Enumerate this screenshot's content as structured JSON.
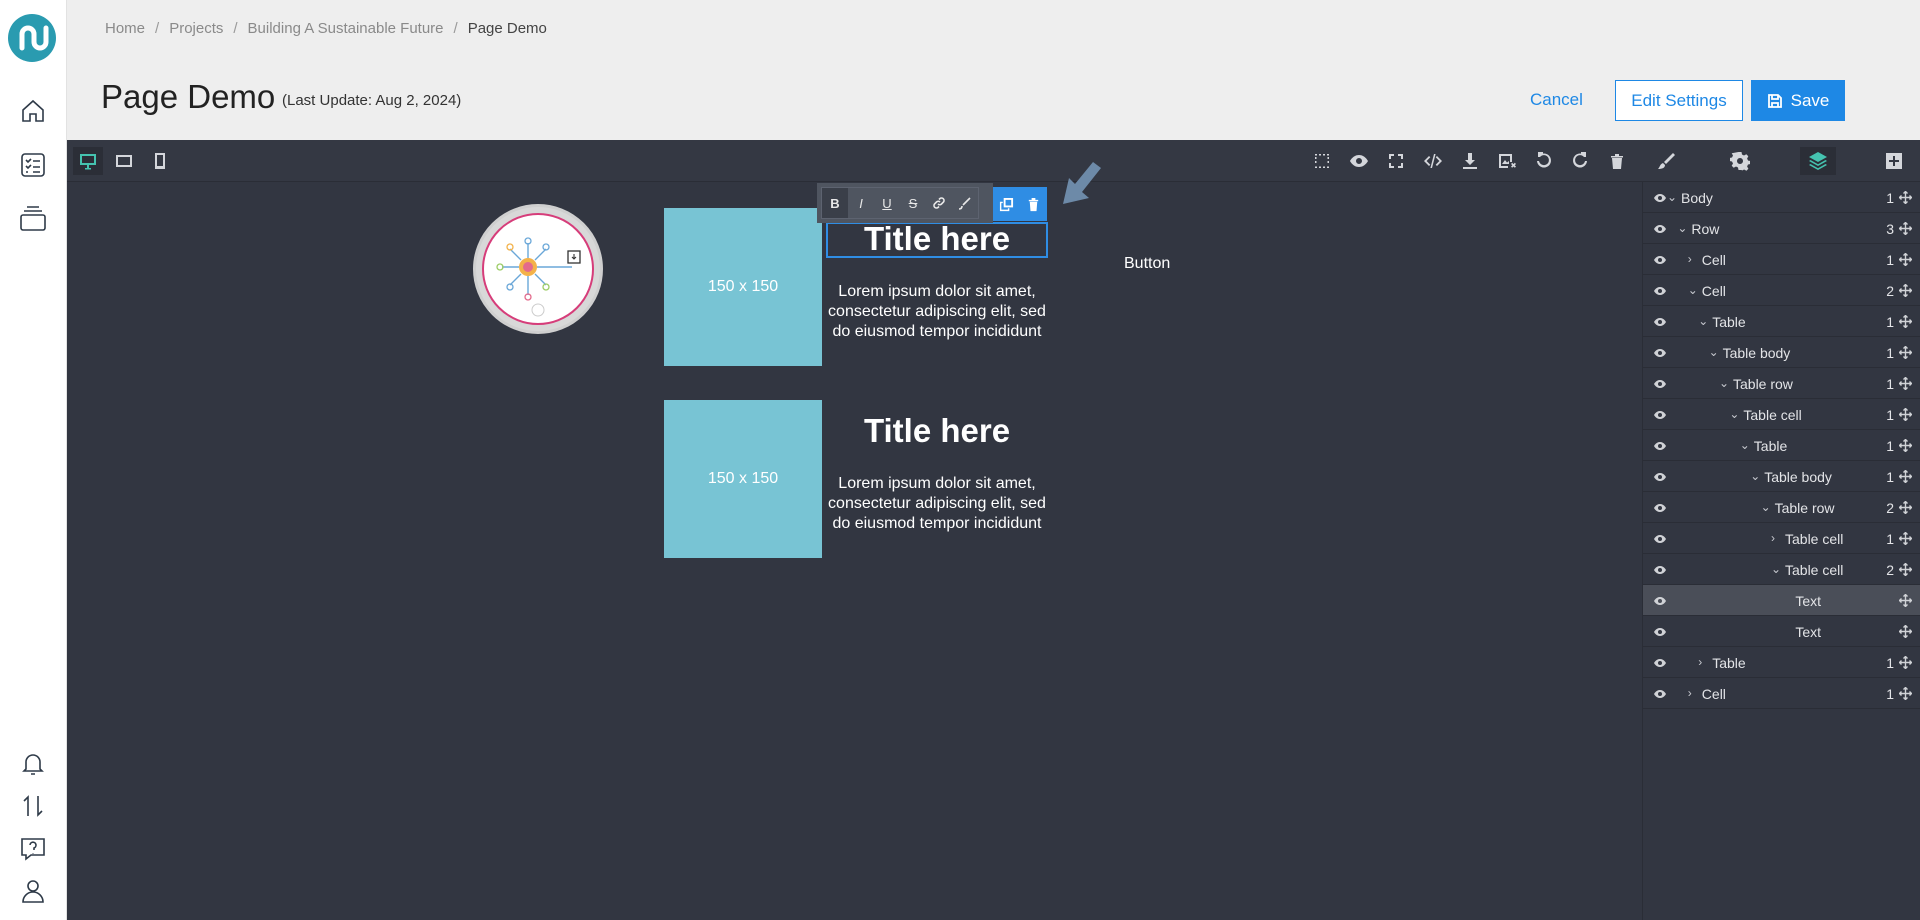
{
  "breadcrumb": [
    "Home",
    "Projects",
    "Building A Sustainable Future",
    "Page Demo"
  ],
  "page": {
    "title": "Page Demo",
    "subtitle": "(Last Update: Aug 2, 2024)"
  },
  "actions": {
    "cancel": "Cancel",
    "edit": "Edit Settings",
    "save": "Save"
  },
  "rail": {
    "logo": "logo-icon",
    "top_icons": [
      "home-icon",
      "checklist-icon",
      "stack-icon"
    ],
    "bottom_icons": [
      "bell-icon",
      "transfer-icon",
      "help-icon",
      "user-icon"
    ]
  },
  "toolbar": {
    "devices": [
      "desktop-icon",
      "tablet-icon",
      "mobile-icon"
    ],
    "active_device": "desktop",
    "commands": [
      "select-outline-icon",
      "preview-eye-icon",
      "fullscreen-icon",
      "code-icon",
      "download-icon",
      "image-remove-icon",
      "undo-icon",
      "redo-icon",
      "trash-icon"
    ],
    "panels": [
      "brush-icon",
      "gear-icon",
      "layers-icon",
      "add-block-icon"
    ],
    "active_panel": "layers",
    "accent": "#45c3b0"
  },
  "rte": {
    "bold": "B",
    "italic": "I",
    "underline": "U",
    "strike": "S"
  },
  "canvas": {
    "cards": [
      {
        "image": "150 x 150",
        "title": "Title here",
        "text": "Lorem ipsum dolor sit amet, consectetur adipiscing elit, sed do eiusmod tempor incididunt"
      },
      {
        "image": "150 x 150",
        "title": "Title here",
        "text": "Lorem ipsum dolor sit amet, consectetur adipiscing elit, sed do eiusmod tempor incididunt"
      }
    ],
    "button": "Button",
    "placeholder_color": "#78c4d4",
    "selection_color": "#2f8de4"
  },
  "layers": [
    {
      "name": "Body",
      "count": "1",
      "depth": 0,
      "caret": "down"
    },
    {
      "name": "Row",
      "count": "3",
      "depth": 1,
      "caret": "down"
    },
    {
      "name": "Cell",
      "count": "1",
      "depth": 2,
      "caret": "right"
    },
    {
      "name": "Cell",
      "count": "2",
      "depth": 2,
      "caret": "down"
    },
    {
      "name": "Table",
      "count": "1",
      "depth": 3,
      "caret": "down"
    },
    {
      "name": "Table body",
      "count": "1",
      "depth": 4,
      "caret": "down"
    },
    {
      "name": "Table row",
      "count": "1",
      "depth": 5,
      "caret": "down"
    },
    {
      "name": "Table cell",
      "count": "1",
      "depth": 6,
      "caret": "down"
    },
    {
      "name": "Table",
      "count": "1",
      "depth": 7,
      "caret": "down"
    },
    {
      "name": "Table body",
      "count": "1",
      "depth": 8,
      "caret": "down"
    },
    {
      "name": "Table row",
      "count": "2",
      "depth": 9,
      "caret": "down"
    },
    {
      "name": "Table cell",
      "count": "1",
      "depth": 10,
      "caret": "right"
    },
    {
      "name": "Table cell",
      "count": "2",
      "depth": 10,
      "caret": "down"
    },
    {
      "name": "Text",
      "count": "",
      "depth": 11,
      "caret": "none",
      "selected": true
    },
    {
      "name": "Text",
      "count": "",
      "depth": 11,
      "caret": "none"
    },
    {
      "name": "Table",
      "count": "1",
      "depth": 3,
      "caret": "right"
    },
    {
      "name": "Cell",
      "count": "1",
      "depth": 2,
      "caret": "right"
    }
  ]
}
